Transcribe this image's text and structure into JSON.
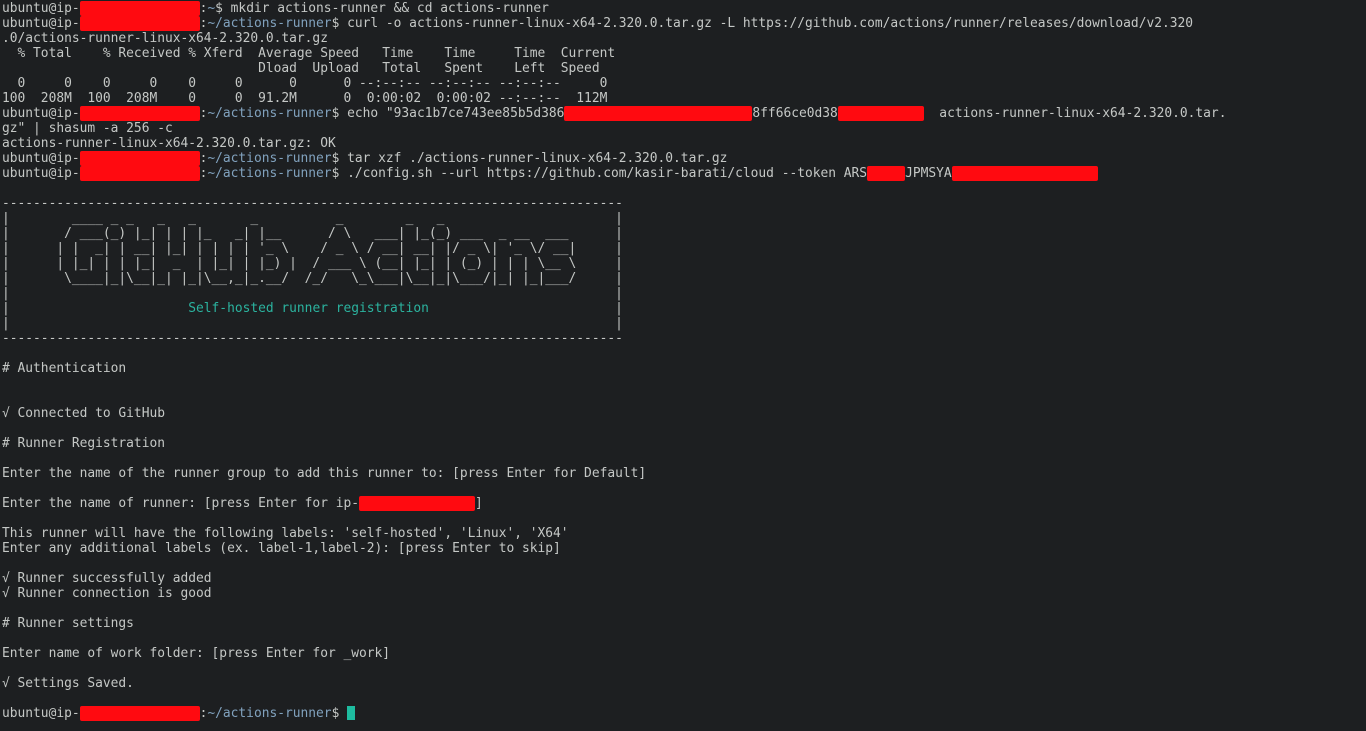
{
  "prompt": {
    "user": "ubuntu@ip-",
    "sep": ":",
    "home_path": "~",
    "runner_path": "~/actions-runner",
    "suffix": "$ "
  },
  "commands": {
    "mkdir": "mkdir actions-runner && cd actions-runner",
    "curl": "curl -o actions-runner-linux-x64-2.320.0.tar.gz -L https://github.com/actions/runner/releases/download/v2.320",
    "curl_wrap": ".0/actions-runner-linux-x64-2.320.0.tar.gz",
    "echo_a": "echo \"93ac1b7ce743ee85b5d386",
    "echo_b": "8ff66ce0d38",
    "echo_c": "  actions-runner-linux-x64-2.320.0.tar.",
    "echo_wrap": "gz\" | shasum -a 256 -c",
    "tar": "tar xzf ./actions-runner-linux-x64-2.320.0.tar.gz",
    "config_a": "./config.sh --url https://github.com/kasir-barati/cloud --token ARS",
    "config_b": "JPMSYA"
  },
  "curl_table": {
    "header1": "  % Total    % Received % Xferd  Average Speed   Time    Time     Time  Current",
    "header2": "                                 Dload  Upload   Total   Spent    Left  Speed",
    "row1": "  0     0    0     0    0     0      0      0 --:--:-- --:--:-- --:--:--     0",
    "row2": "100  208M  100  208M    0     0  91.2M      0  0:00:02  0:00:02 --:--:--  112M"
  },
  "shasum_result": "actions-runner-linux-x64-2.320.0.tar.gz: OK",
  "banner": {
    "rule": "--------------------------------------------------------------------------------",
    "art": [
      "|        ____ _ _   _   _       _          _        _   _                      |",
      "|       / ___(_) |_| | | |_   _| |__      / \\   ___| |_(_) ___  _ __  ___      |",
      "|      | |  _| | __| |_| | | | | '_ \\    / _ \\ / __| __| |/ _ \\| '_ \\/ __|     |",
      "|      | |_| | | |_|  _  | |_| | |_) |  / ___ \\ (__| |_| | (_) | | | \\__ \\     |",
      "|       \\____|_|\\__|_| |_|\\__,_|_.__/  /_/   \\_\\___|\\__|_|\\___/|_| |_|___/     |",
      "|                                                                              |"
    ],
    "subtitle_lead": "|                       ",
    "subtitle": "Self-hosted runner registration",
    "subtitle_tail": "                        |",
    "blank": "|                                                                              |"
  },
  "config_output": {
    "auth_header": "# Authentication",
    "connected": "√ Connected to GitHub",
    "registration_header": "# Runner Registration",
    "group_prompt": "Enter the name of the runner group to add this runner to: [press Enter for Default]",
    "name_prompt": "Enter the name of runner: [press Enter for ip-",
    "name_prompt_end": "]",
    "labels_info": "This runner will have the following labels: 'self-hosted', 'Linux', 'X64'",
    "labels_prompt": "Enter any additional labels (ex. label-1,label-2): [press Enter to skip]",
    "added": "√ Runner successfully added",
    "connection_good": "√ Runner connection is good",
    "settings_header": "# Runner settings",
    "work_folder_prompt": "Enter name of work folder: [press Enter for _work]",
    "saved": "√ Settings Saved."
  },
  "colors": {
    "background": "#1d1f21",
    "foreground": "#c5c8c6",
    "path": "#81a2be",
    "banner_subtitle": "#2bb39f",
    "cursor": "#1ebca0",
    "redaction": "#ff0a10"
  }
}
